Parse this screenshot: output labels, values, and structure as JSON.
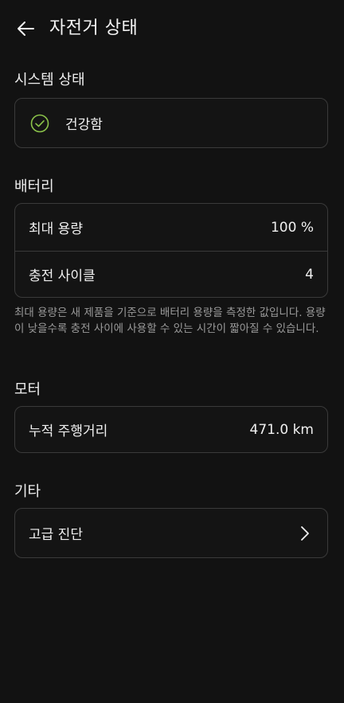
{
  "header": {
    "title": "자전거 상태",
    "back_icon": "arrow-left-icon"
  },
  "system": {
    "section_title": "시스템 상태",
    "status_label": "건강함",
    "status_icon": "check-circle-icon",
    "status_color": "#8bc34a"
  },
  "battery": {
    "section_title": "배터리",
    "max_capacity_label": "최대 용량",
    "max_capacity_value": "100 %",
    "charge_cycles_label": "충전 사이클",
    "charge_cycles_value": "4",
    "note": "최대 용량은 새 제품을 기준으로 배터리 용량을 측정한 값입니다. 용량이 낮을수록 충전 사이에 사용할 수 있는 시간이 짧아질 수 있습니다."
  },
  "motor": {
    "section_title": "모터",
    "odometer_label": "누적 주행거리",
    "odometer_value": "471.0 km"
  },
  "other": {
    "section_title": "기타",
    "advanced_diagnostics_label": "고급 진단",
    "chevron_icon": "chevron-right-icon"
  },
  "colors": {
    "background": "#121212",
    "card_border": "#3a3a3a",
    "accent_green": "#8bc34a"
  }
}
